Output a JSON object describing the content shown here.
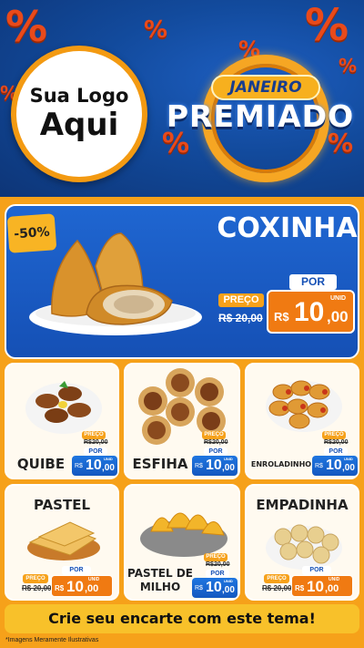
{
  "header": {
    "logo_line1": "Sua Logo",
    "logo_line2": "Aqui",
    "badge_top": "JANEIRO",
    "badge_main": "PREMIADO",
    "percent_symbol": "%"
  },
  "featured": {
    "discount": "-50%",
    "name": "COXINHA",
    "por_label": "POR",
    "preco_label": "PREÇO",
    "old_price": "R$ 20,00",
    "currency": "R$",
    "price_int": "10",
    "price_dec": ",00",
    "unit": "UNID"
  },
  "products": [
    {
      "name": "QUIBE",
      "preco_label": "PREÇO",
      "old_price": "R$20,00",
      "por_label": "POR",
      "currency": "R$",
      "price_int": "10",
      "price_dec": ",00",
      "unit": "UNID"
    },
    {
      "name": "ESFIHA",
      "preco_label": "PREÇO",
      "old_price": "R$20,00",
      "por_label": "POR",
      "currency": "R$",
      "price_int": "10",
      "price_dec": ",00",
      "unit": "UNID"
    },
    {
      "name": "ENROLADINHO",
      "preco_label": "PREÇO",
      "old_price": "R$20,00",
      "por_label": "POR",
      "currency": "R$",
      "price_int": "10",
      "price_dec": ",00",
      "unit": "UNID"
    },
    {
      "name": "PASTEL",
      "preco_label": "PREÇO",
      "old_price": "R$ 20,00",
      "por_label": "POR",
      "currency": "R$",
      "price_int": "10",
      "price_dec": ",00",
      "unit": "UNID"
    },
    {
      "name_l1": "PASTEL DE",
      "name_l2": "MILHO",
      "preco_label": "PREÇO",
      "old_price": "R$20,00",
      "por_label": "POR",
      "currency": "R$",
      "price_int": "10",
      "price_dec": ",00",
      "unit": "UNID"
    },
    {
      "name": "EMPADINHA",
      "preco_label": "PREÇO",
      "old_price": "R$ 20,00",
      "por_label": "POR",
      "currency": "R$",
      "price_int": "10",
      "price_dec": ",00",
      "unit": "UNID"
    }
  ],
  "footer": {
    "cta": "Crie seu encarte com este tema!",
    "disclaimer": "*Imagens Meramente Ilustrativas"
  },
  "colors": {
    "header_blue": "#124a9c",
    "orange": "#f6a11a",
    "price_blue": "#1458c0",
    "percent_red": "#e84a1b"
  }
}
